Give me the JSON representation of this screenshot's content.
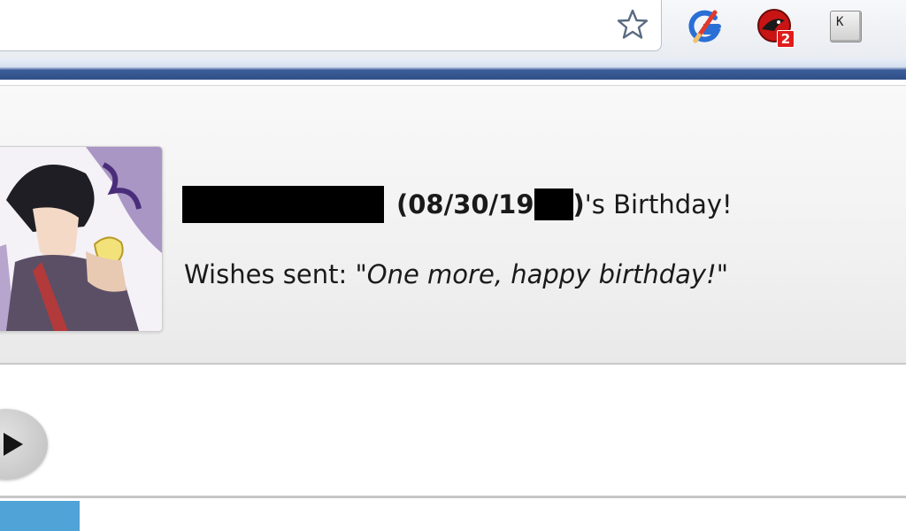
{
  "toolbar": {
    "bookmark_icon": "star-icon",
    "extensions": [
      {
        "name": "google-edit-extension",
        "icon": "google-pencil-icon"
      },
      {
        "name": "red-extension",
        "icon": "red-bird-icon",
        "badge": "2",
        "badge_color": "#e11b1b"
      },
      {
        "name": "k-key-extension",
        "icon": "k-key-icon",
        "key_label": "K"
      }
    ]
  },
  "birthday": {
    "date_open": "(08/30/19",
    "date_close": ")",
    "suffix": "'s Birthday!",
    "wishes_label": "Wishes sent: ",
    "wishes_message": "\"One more, happy birthday!\""
  },
  "colors": {
    "accent_blue": "#2f4f87",
    "tab_blue": "#4fa3d6"
  }
}
